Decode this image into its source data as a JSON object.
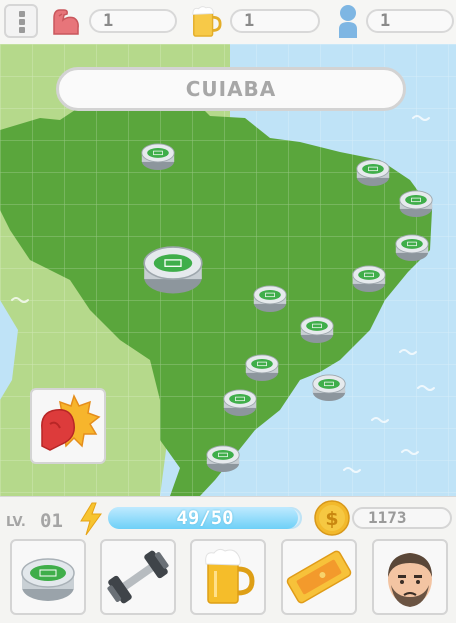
{
  "topbar": {
    "menu_icon": "menu-icon",
    "strength": {
      "icon": "flexed-arm-icon",
      "value": "1"
    },
    "beer": {
      "icon": "beer-mug-icon",
      "value": "1"
    },
    "fans": {
      "icon": "person-icon",
      "value": "1"
    }
  },
  "map": {
    "city_name": "CUIABA",
    "land_color": "#5aa63c",
    "ocean_color": "#bfe3f7",
    "stadium_count": 12
  },
  "power_card": {
    "icon": "boxing-glove-icon"
  },
  "player": {
    "level_label": "LV.",
    "level_value": "01",
    "energy_icon": "lightning-icon",
    "energy_text": "49/50",
    "energy_fraction": 0.98,
    "coin_icon": "dollar-coin-icon",
    "coins": "1173"
  },
  "actions": [
    {
      "name": "stadium",
      "icon": "stadium-icon"
    },
    {
      "name": "training",
      "icon": "dumbbell-icon"
    },
    {
      "name": "beer",
      "icon": "beer-mug-icon"
    },
    {
      "name": "ticket",
      "icon": "ticket-icon"
    },
    {
      "name": "profile",
      "icon": "player-avatar-icon"
    }
  ]
}
